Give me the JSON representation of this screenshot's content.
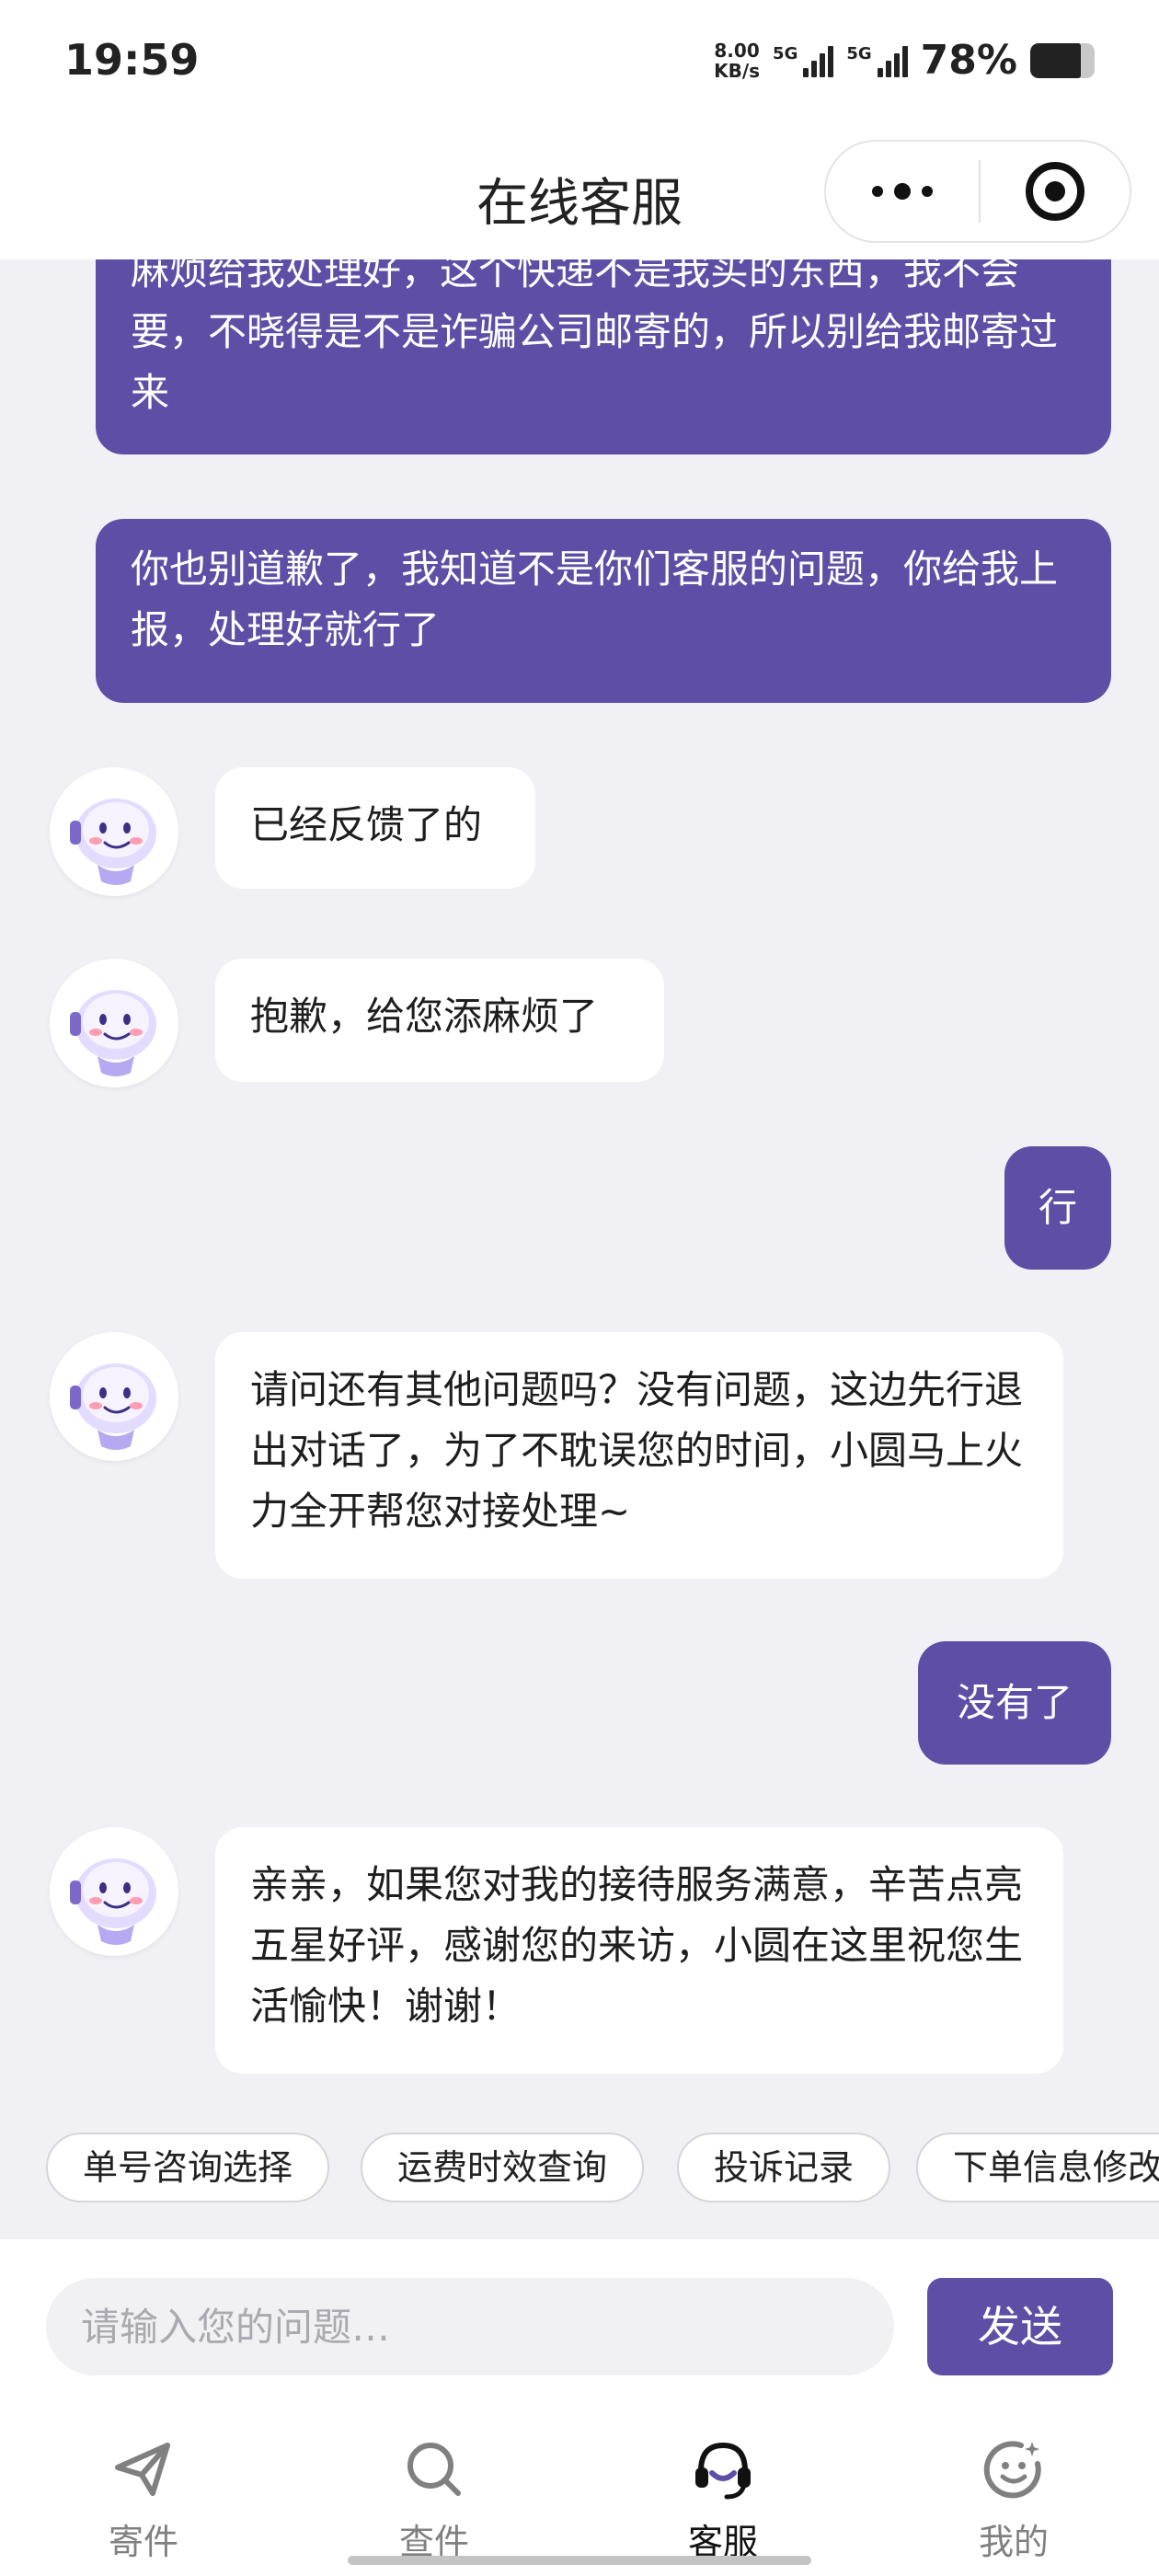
{
  "status_bar": {
    "time": "19:59",
    "net_speed_value": "8.00",
    "net_speed_unit": "KB/s",
    "sim1_label": "5G",
    "sim2_label": "5G",
    "battery_pct": "78%"
  },
  "header": {
    "title": "在线客服",
    "more_icon": "more-dots-icon",
    "close_icon": "target-close-icon"
  },
  "messages": [
    {
      "role": "user",
      "text": "麻烦给我处理好，这个快递不是我买的东西，我不会要，不晓得是不是诈骗公司邮寄的，所以别给我邮寄过来"
    },
    {
      "role": "user",
      "text": "你也别道歉了，我知道不是你们客服的问题，你给我上报，处理好就行了"
    },
    {
      "role": "bot",
      "text": "已经反馈了的"
    },
    {
      "role": "bot",
      "text": "抱歉，给您添麻烦了"
    },
    {
      "role": "user",
      "text": "行"
    },
    {
      "role": "bot",
      "text": "请问还有其他问题吗？没有问题，这边先行退出对话了，为了不耽误您的时间，小圆马上火力全开帮您对接处理~"
    },
    {
      "role": "user",
      "text": "没有了"
    },
    {
      "role": "bot",
      "text": "亲亲，如果您对我的接待服务满意，辛苦点亮五星好评，感谢您的来访，小圆在这里祝您生活愉快！谢谢！"
    }
  ],
  "quick_replies": [
    "单号咨询选择",
    "运费时效查询",
    "投诉记录",
    "下单信息修改"
  ],
  "input": {
    "placeholder": "请输入您的问题…",
    "value": "",
    "send_label": "发送"
  },
  "tabs": [
    {
      "label": "寄件",
      "icon": "send-icon",
      "active": false
    },
    {
      "label": "查件",
      "icon": "search-icon",
      "active": false
    },
    {
      "label": "客服",
      "icon": "headset-icon",
      "active": true
    },
    {
      "label": "我的",
      "icon": "profile-face-icon",
      "active": false
    }
  ],
  "colors": {
    "accent": "#5e4ea6",
    "background": "#f1f1f5",
    "bot_bubble": "#ffffff"
  }
}
